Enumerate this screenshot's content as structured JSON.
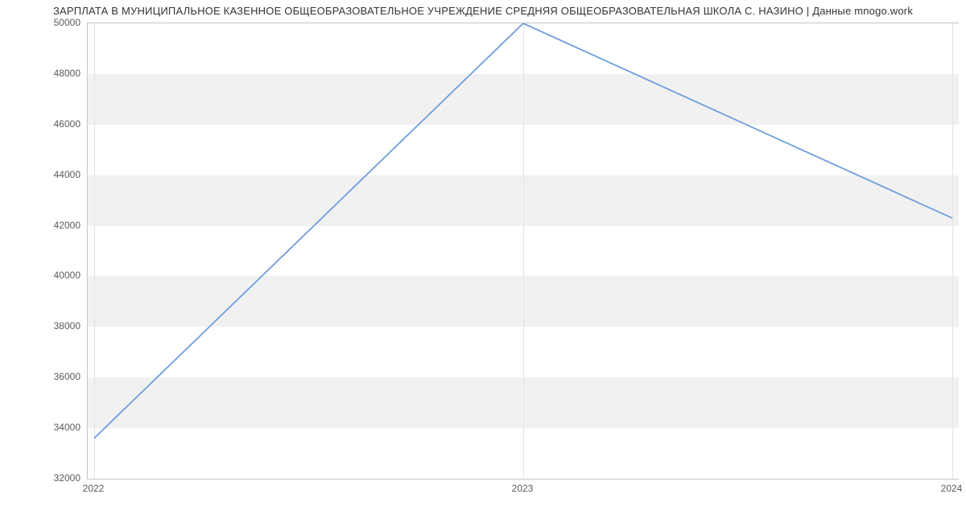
{
  "chart_data": {
    "type": "line",
    "title": "ЗАРПЛАТА В МУНИЦИПАЛЬНОЕ КАЗЕННОЕ ОБЩЕОБРАЗОВАТЕЛЬНОЕ УЧРЕЖДЕНИЕ СРЕДНЯЯ ОБЩЕОБРАЗОВАТЕЛЬНАЯ ШКОЛА С. НАЗИНО | Данные mnogo.work",
    "xlabel": "",
    "ylabel": "",
    "categories": [
      "2022",
      "2023",
      "2024"
    ],
    "values": [
      33600,
      50000,
      42300
    ],
    "ylim": [
      32000,
      50000
    ],
    "yticks": [
      32000,
      34000,
      36000,
      38000,
      40000,
      42000,
      44000,
      46000,
      48000,
      50000
    ],
    "xticks": [
      "2022",
      "2023",
      "2024"
    ],
    "bands": true
  }
}
